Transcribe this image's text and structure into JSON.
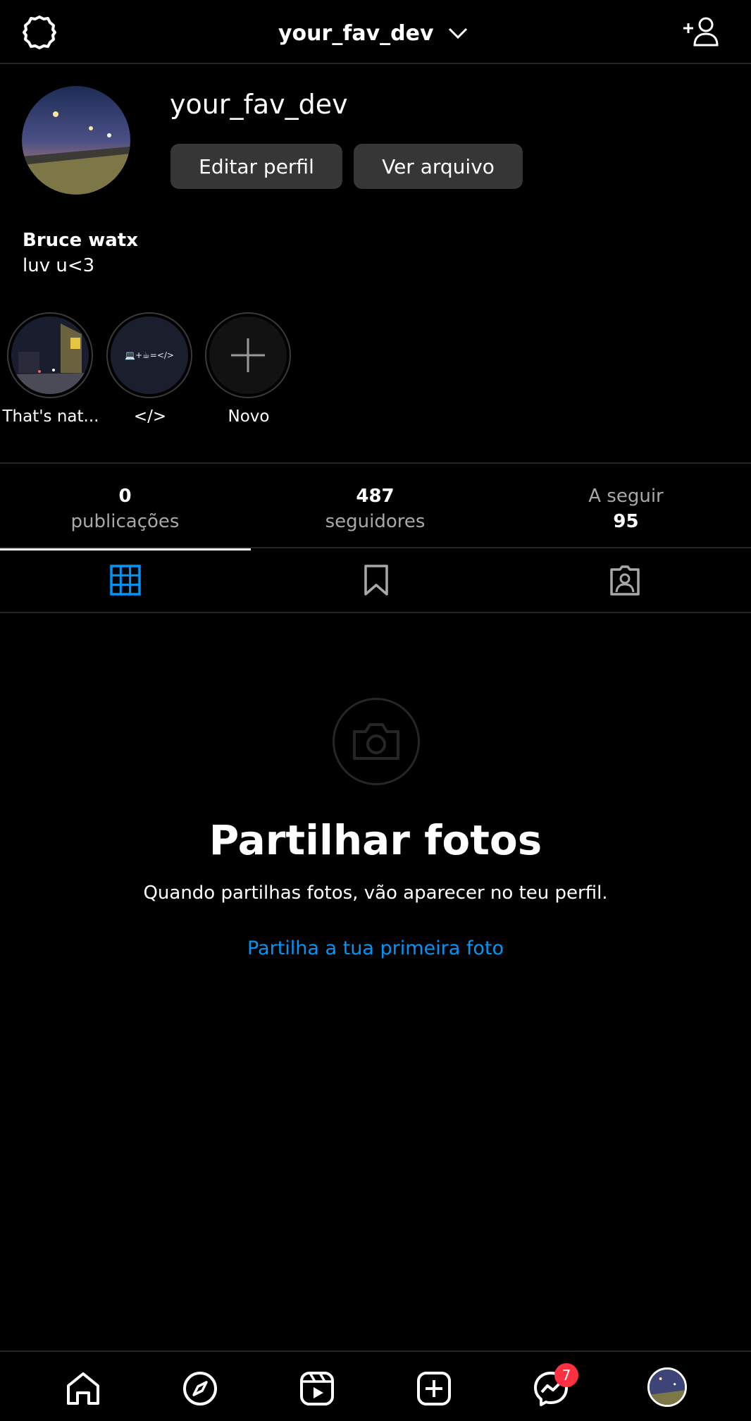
{
  "header": {
    "username": "your_fav_dev"
  },
  "profile": {
    "username": "your_fav_dev",
    "edit_label": "Editar perfil",
    "archive_label": "Ver arquivo",
    "name": "Bruce watx",
    "bio": "luv u<3"
  },
  "highlights": [
    {
      "label": "That's nat..."
    },
    {
      "label": "</>",
      "cover_text": "💻+☕=</>"
    },
    {
      "label": "Novo"
    }
  ],
  "stats": {
    "posts": {
      "value": "0",
      "label": "publicações"
    },
    "followers": {
      "value": "487",
      "label": "seguidores"
    },
    "following": {
      "label": "A seguir",
      "value": "95"
    }
  },
  "tabs": [
    "posts-grid",
    "saved",
    "tagged"
  ],
  "empty_state": {
    "title": "Partilhar fotos",
    "subtitle": "Quando partilhas fotos, vão aparecer no teu perfil.",
    "link": "Partilha a tua primeira foto"
  },
  "bottom_nav": {
    "items": [
      "home-icon",
      "explore-icon",
      "reels-icon",
      "create-icon",
      "messenger-icon",
      "profile-avatar"
    ],
    "messenger_badge": "7"
  },
  "colors": {
    "accent": "#0095f6",
    "badge": "#ff3040",
    "button_bg": "#363636",
    "divider": "#262626"
  }
}
